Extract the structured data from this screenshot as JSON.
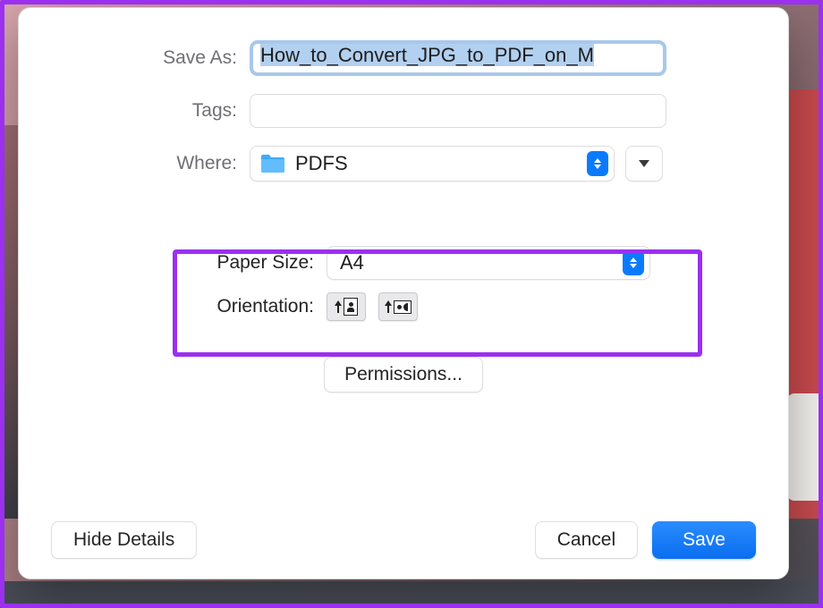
{
  "labels": {
    "save_as": "Save As:",
    "tags": "Tags:",
    "where": "Where:",
    "paper_size": "Paper Size:",
    "orientation": "Orientation:"
  },
  "save_as": {
    "value": "How_to_Convert_JPG_to_PDF_on_M"
  },
  "where": {
    "folder_name": "PDFS"
  },
  "paper_size": {
    "value": "A4"
  },
  "buttons": {
    "permissions": "Permissions...",
    "hide_details": "Hide Details",
    "cancel": "Cancel",
    "save": "Save"
  }
}
